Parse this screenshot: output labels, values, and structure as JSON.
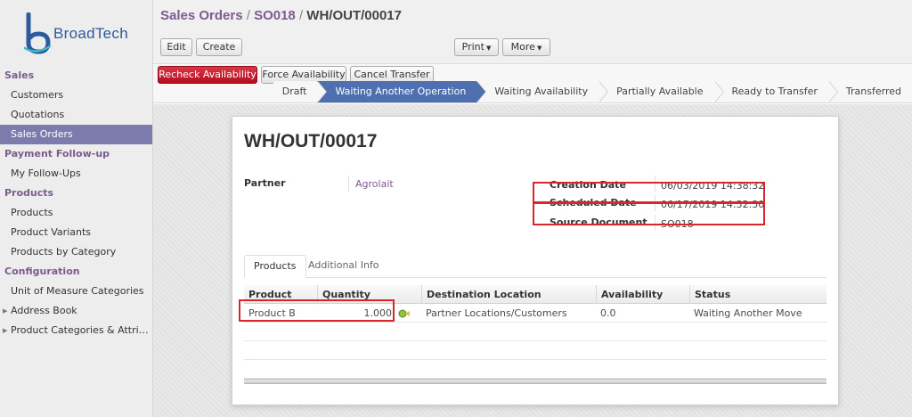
{
  "brand": {
    "name": "BroadTech",
    "colors": {
      "primary": "#7c5b8f",
      "accent": "#4e6fb0",
      "danger": "#d8262c"
    }
  },
  "sidebar": {
    "sections": [
      {
        "title": "Sales",
        "items": [
          {
            "label": "Customers"
          },
          {
            "label": "Quotations"
          },
          {
            "label": "Sales Orders",
            "active": true
          }
        ]
      },
      {
        "title": "Payment Follow-up",
        "items": [
          {
            "label": "My Follow-Ups"
          }
        ]
      },
      {
        "title": "Products",
        "items": [
          {
            "label": "Products"
          },
          {
            "label": "Product Variants"
          },
          {
            "label": "Products by Category"
          }
        ]
      },
      {
        "title": "Configuration",
        "items": [
          {
            "label": "Unit of Measure Categories"
          },
          {
            "label": "Address Book",
            "expandable": true
          },
          {
            "label": "Product Categories & Attri…",
            "expandable": true
          }
        ]
      }
    ]
  },
  "header": {
    "breadcrumb": {
      "root": "Sales Orders",
      "sep1": "/",
      "parent": "SO018",
      "sep2": "/",
      "current": "WH/OUT/00017"
    },
    "buttons": {
      "edit": "Edit",
      "create": "Create",
      "print": "Print",
      "more": "More"
    }
  },
  "statusbar": {
    "actions": {
      "recheck": "Recheck Availability",
      "force": "Force Availability",
      "cancel": "Cancel Transfer"
    },
    "stages": [
      {
        "label": "Draft"
      },
      {
        "label": "Waiting Another Operation",
        "active": true
      },
      {
        "label": "Waiting Availability"
      },
      {
        "label": "Partially Available"
      },
      {
        "label": "Ready to Transfer"
      },
      {
        "label": "Transferred"
      }
    ]
  },
  "form": {
    "title": "WH/OUT/00017",
    "partner_label": "Partner",
    "partner_value": "Agrolait",
    "creation_date_label": "Creation Date",
    "creation_date_value": "06/03/2019 14:38:32",
    "scheduled_date_label": "Scheduled Date",
    "scheduled_date_value": "06/17/2019 14:32:30",
    "source_document_label": "Source Document",
    "source_document_value": "SO018",
    "tabs": {
      "products": "Products",
      "additional": "Additional Info"
    },
    "table": {
      "headers": {
        "product": "Product",
        "quantity": "Quantity",
        "destination": "Destination Location",
        "availability": "Availability",
        "status": "Status"
      },
      "rows": [
        {
          "product": "Product B",
          "quantity": "1.000",
          "destination": "Partner Locations/Customers",
          "availability": "0.0",
          "status": "Waiting Another Move"
        }
      ]
    }
  }
}
